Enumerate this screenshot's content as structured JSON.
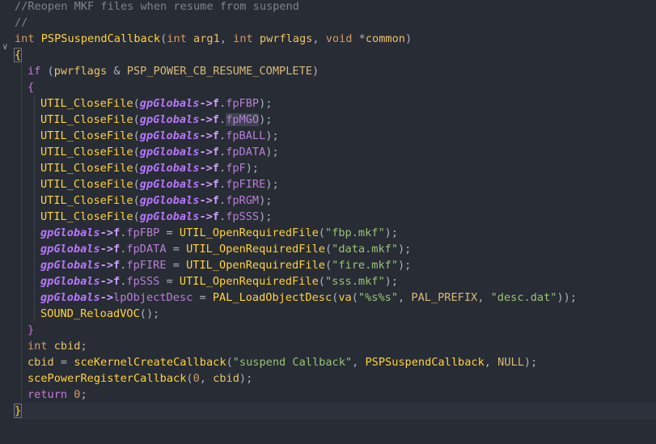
{
  "editor": {
    "colors": {
      "background": "#282c34",
      "comment": "#7f848e",
      "keyword": "#c678dd",
      "type": "#d19a66",
      "function": "#ffd43b",
      "global": "#b777ff",
      "string": "#98c379",
      "number": "#d19a66"
    },
    "lines": [
      {
        "indent": 0,
        "tokens": [
          {
            "c": "t-comment",
            "t": "//Reopen MKF files when resume from suspend"
          }
        ]
      },
      {
        "indent": 0,
        "tokens": [
          {
            "c": "t-comment",
            "t": "//"
          }
        ]
      },
      {
        "indent": 0,
        "fold": "∨",
        "tokens": [
          {
            "c": "t-type",
            "t": "int"
          },
          {
            "c": "",
            "t": " "
          },
          {
            "c": "t-fn",
            "t": "PSPSuspendCallback"
          },
          {
            "c": "",
            "t": "("
          },
          {
            "c": "t-type",
            "t": "int"
          },
          {
            "c": "",
            "t": " "
          },
          {
            "c": "t-param",
            "t": "arg1"
          },
          {
            "c": "",
            "t": ", "
          },
          {
            "c": "t-type",
            "t": "int"
          },
          {
            "c": "",
            "t": " "
          },
          {
            "c": "t-param",
            "t": "pwrflags"
          },
          {
            "c": "",
            "t": ", "
          },
          {
            "c": "t-type",
            "t": "void"
          },
          {
            "c": "",
            "t": " *"
          },
          {
            "c": "t-param",
            "t": "common"
          },
          {
            "c": "",
            "t": ")"
          }
        ]
      },
      {
        "indent": 0,
        "tokens": [
          {
            "c": "t-brace-hl",
            "t": "{"
          }
        ]
      },
      {
        "indent": 1,
        "tokens": [
          {
            "c": "t-kw",
            "t": "if"
          },
          {
            "c": "",
            "t": " ("
          },
          {
            "c": "t-param",
            "t": "pwrflags"
          },
          {
            "c": "",
            "t": " & "
          },
          {
            "c": "t-const",
            "t": "PSP_POWER_CB_RESUME_COMPLETE"
          },
          {
            "c": "",
            "t": ")"
          }
        ]
      },
      {
        "indent": 1,
        "tokens": [
          {
            "c": "t-kw",
            "t": "{"
          }
        ]
      },
      {
        "indent": 2,
        "tokens": [
          {
            "c": "t-fn",
            "t": "UTIL_CloseFile"
          },
          {
            "c": "",
            "t": "("
          },
          {
            "c": "t-global",
            "t": "gpGlobals"
          },
          {
            "c": "t-op",
            "t": "->f"
          },
          {
            "c": "",
            "t": "."
          },
          {
            "c": "t-field",
            "t": "fpFBP"
          },
          {
            "c": "",
            "t": ");"
          }
        ]
      },
      {
        "indent": 2,
        "tokens": [
          {
            "c": "t-fn",
            "t": "UTIL_CloseFile"
          },
          {
            "c": "",
            "t": "("
          },
          {
            "c": "t-global",
            "t": "gpGlobals"
          },
          {
            "c": "t-op",
            "t": "->f"
          },
          {
            "c": "",
            "t": "."
          },
          {
            "c": "t-field t-sel",
            "t": "fpMGO"
          },
          {
            "c": "",
            "t": ");"
          }
        ]
      },
      {
        "indent": 2,
        "tokens": [
          {
            "c": "t-fn",
            "t": "UTIL_CloseFile"
          },
          {
            "c": "",
            "t": "("
          },
          {
            "c": "t-global",
            "t": "gpGlobals"
          },
          {
            "c": "t-op",
            "t": "->f"
          },
          {
            "c": "",
            "t": "."
          },
          {
            "c": "t-field",
            "t": "fpBALL"
          },
          {
            "c": "",
            "t": ");"
          }
        ]
      },
      {
        "indent": 2,
        "tokens": [
          {
            "c": "t-fn",
            "t": "UTIL_CloseFile"
          },
          {
            "c": "",
            "t": "("
          },
          {
            "c": "t-global",
            "t": "gpGlobals"
          },
          {
            "c": "t-op",
            "t": "->f"
          },
          {
            "c": "",
            "t": "."
          },
          {
            "c": "t-field",
            "t": "fpDATA"
          },
          {
            "c": "",
            "t": ");"
          }
        ]
      },
      {
        "indent": 2,
        "tokens": [
          {
            "c": "t-fn",
            "t": "UTIL_CloseFile"
          },
          {
            "c": "",
            "t": "("
          },
          {
            "c": "t-global",
            "t": "gpGlobals"
          },
          {
            "c": "t-op",
            "t": "->f"
          },
          {
            "c": "",
            "t": "."
          },
          {
            "c": "t-field",
            "t": "fpF"
          },
          {
            "c": "",
            "t": ");"
          }
        ]
      },
      {
        "indent": 2,
        "tokens": [
          {
            "c": "t-fn",
            "t": "UTIL_CloseFile"
          },
          {
            "c": "",
            "t": "("
          },
          {
            "c": "t-global",
            "t": "gpGlobals"
          },
          {
            "c": "t-op",
            "t": "->f"
          },
          {
            "c": "",
            "t": "."
          },
          {
            "c": "t-field",
            "t": "fpFIRE"
          },
          {
            "c": "",
            "t": ");"
          }
        ]
      },
      {
        "indent": 2,
        "tokens": [
          {
            "c": "t-fn",
            "t": "UTIL_CloseFile"
          },
          {
            "c": "",
            "t": "("
          },
          {
            "c": "t-global",
            "t": "gpGlobals"
          },
          {
            "c": "t-op",
            "t": "->f"
          },
          {
            "c": "",
            "t": "."
          },
          {
            "c": "t-field",
            "t": "fpRGM"
          },
          {
            "c": "",
            "t": ");"
          }
        ]
      },
      {
        "indent": 2,
        "tokens": [
          {
            "c": "t-fn",
            "t": "UTIL_CloseFile"
          },
          {
            "c": "",
            "t": "("
          },
          {
            "c": "t-global",
            "t": "gpGlobals"
          },
          {
            "c": "t-op",
            "t": "->f"
          },
          {
            "c": "",
            "t": "."
          },
          {
            "c": "t-field",
            "t": "fpSSS"
          },
          {
            "c": "",
            "t": ");"
          }
        ]
      },
      {
        "indent": 2,
        "tokens": [
          {
            "c": "t-global",
            "t": "gpGlobals"
          },
          {
            "c": "t-op",
            "t": "->f"
          },
          {
            "c": "",
            "t": "."
          },
          {
            "c": "t-field",
            "t": "fpFBP"
          },
          {
            "c": "",
            "t": " = "
          },
          {
            "c": "t-fn",
            "t": "UTIL_OpenRequiredFile"
          },
          {
            "c": "",
            "t": "("
          },
          {
            "c": "t-str",
            "t": "\"fbp.mkf\""
          },
          {
            "c": "",
            "t": ");"
          }
        ]
      },
      {
        "indent": 2,
        "tokens": [
          {
            "c": "t-global",
            "t": "gpGlobals"
          },
          {
            "c": "t-op",
            "t": "->f"
          },
          {
            "c": "",
            "t": "."
          },
          {
            "c": "t-field",
            "t": "fpDATA"
          },
          {
            "c": "",
            "t": " = "
          },
          {
            "c": "t-fn",
            "t": "UTIL_OpenRequiredFile"
          },
          {
            "c": "",
            "t": "("
          },
          {
            "c": "t-str",
            "t": "\"data.mkf\""
          },
          {
            "c": "",
            "t": ");"
          }
        ]
      },
      {
        "indent": 2,
        "tokens": [
          {
            "c": "t-global",
            "t": "gpGlobals"
          },
          {
            "c": "t-op",
            "t": "->f"
          },
          {
            "c": "",
            "t": "."
          },
          {
            "c": "t-field",
            "t": "fpFIRE"
          },
          {
            "c": "",
            "t": " = "
          },
          {
            "c": "t-fn",
            "t": "UTIL_OpenRequiredFile"
          },
          {
            "c": "",
            "t": "("
          },
          {
            "c": "t-str",
            "t": "\"fire.mkf\""
          },
          {
            "c": "",
            "t": ");"
          }
        ]
      },
      {
        "indent": 2,
        "tokens": [
          {
            "c": "t-global",
            "t": "gpGlobals"
          },
          {
            "c": "t-op",
            "t": "->f"
          },
          {
            "c": "",
            "t": "."
          },
          {
            "c": "t-field",
            "t": "fpSSS"
          },
          {
            "c": "",
            "t": " = "
          },
          {
            "c": "t-fn",
            "t": "UTIL_OpenRequiredFile"
          },
          {
            "c": "",
            "t": "("
          },
          {
            "c": "t-str",
            "t": "\"sss.mkf\""
          },
          {
            "c": "",
            "t": ");"
          }
        ]
      },
      {
        "indent": 2,
        "tokens": [
          {
            "c": "t-global",
            "t": "gpGlobals"
          },
          {
            "c": "t-op",
            "t": "->"
          },
          {
            "c": "t-field",
            "t": "lpObjectDesc"
          },
          {
            "c": "",
            "t": " = "
          },
          {
            "c": "t-fn",
            "t": "PAL_LoadObjectDesc"
          },
          {
            "c": "",
            "t": "("
          },
          {
            "c": "t-fn",
            "t": "va"
          },
          {
            "c": "",
            "t": "("
          },
          {
            "c": "t-str",
            "t": "\"%s%s\""
          },
          {
            "c": "",
            "t": ", "
          },
          {
            "c": "t-const",
            "t": "PAL_PREFIX"
          },
          {
            "c": "",
            "t": ", "
          },
          {
            "c": "t-str",
            "t": "\"desc.dat\""
          },
          {
            "c": "",
            "t": "));"
          }
        ]
      },
      {
        "indent": 2,
        "tokens": [
          {
            "c": "t-fn",
            "t": "SOUND_ReloadVOC"
          },
          {
            "c": "",
            "t": "();"
          }
        ]
      },
      {
        "indent": 1,
        "tokens": [
          {
            "c": "t-kw",
            "t": "}"
          }
        ]
      },
      {
        "indent": 1,
        "tokens": [
          {
            "c": "t-type",
            "t": "int"
          },
          {
            "c": "",
            "t": " "
          },
          {
            "c": "t-param",
            "t": "cbid"
          },
          {
            "c": "",
            "t": ";"
          }
        ]
      },
      {
        "indent": 1,
        "tokens": [
          {
            "c": "t-param",
            "t": "cbid"
          },
          {
            "c": "",
            "t": " = "
          },
          {
            "c": "t-fn",
            "t": "sceKernelCreateCallback"
          },
          {
            "c": "",
            "t": "("
          },
          {
            "c": "t-str",
            "t": "\"suspend Callback\""
          },
          {
            "c": "",
            "t": ", "
          },
          {
            "c": "t-fn",
            "t": "PSPSuspendCallback"
          },
          {
            "c": "",
            "t": ", "
          },
          {
            "c": "t-const",
            "t": "NULL"
          },
          {
            "c": "",
            "t": ");"
          }
        ]
      },
      {
        "indent": 1,
        "tokens": [
          {
            "c": "t-fn",
            "t": "scePowerRegisterCallback"
          },
          {
            "c": "",
            "t": "("
          },
          {
            "c": "t-num",
            "t": "0"
          },
          {
            "c": "",
            "t": ", "
          },
          {
            "c": "t-param",
            "t": "cbid"
          },
          {
            "c": "",
            "t": ");"
          }
        ]
      },
      {
        "indent": 1,
        "tokens": [
          {
            "c": "t-kw",
            "t": "return"
          },
          {
            "c": "",
            "t": " "
          },
          {
            "c": "t-num",
            "t": "0"
          },
          {
            "c": "",
            "t": ";"
          }
        ]
      },
      {
        "indent": 0,
        "current": true,
        "tokens": [
          {
            "c": "t-brace-hl",
            "t": "}"
          }
        ]
      },
      {
        "indent": 0,
        "tokens": []
      },
      {
        "indent": 0,
        "tokens": []
      }
    ]
  }
}
